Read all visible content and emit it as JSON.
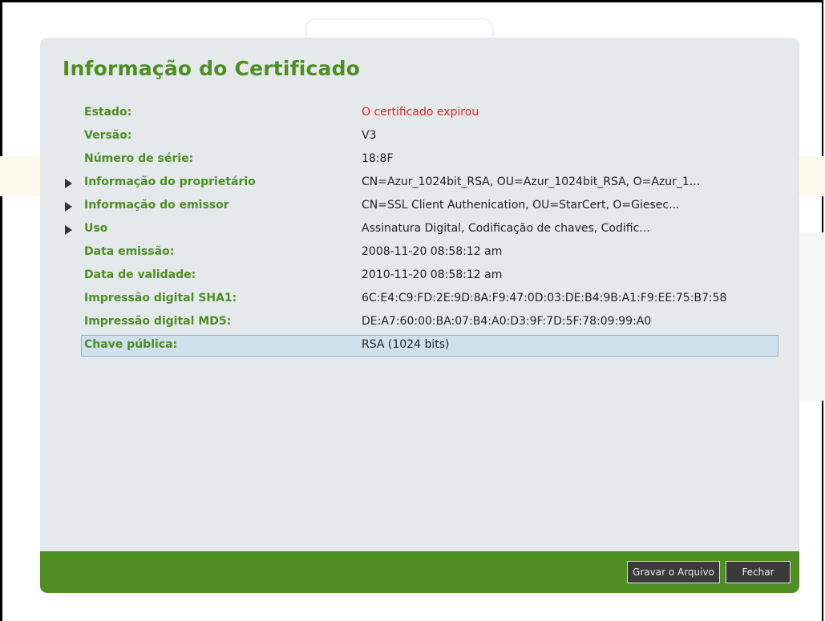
{
  "dialog": {
    "title": "Informação do Certificado",
    "rows": [
      {
        "label": "Estado:",
        "value": "O certificado expirou",
        "status": "error",
        "expandable": false
      },
      {
        "label": "Versão:",
        "value": "V3",
        "expandable": false
      },
      {
        "label": "Número de série:",
        "value": "18:8F",
        "expandable": false
      },
      {
        "label": "Informação do proprietário",
        "value": "CN=Azur_1024bit_RSA, OU=Azur_1024bit_RSA, O=Azur_1...",
        "expandable": true
      },
      {
        "label": "Informação do emissor",
        "value": "CN=SSL Client Authenication, OU=StarCert, O=Giesec...",
        "expandable": true
      },
      {
        "label": "Uso",
        "value": "Assinatura Digital, Codificação de chaves, Codific...",
        "expandable": true
      },
      {
        "label": "Data emissão:",
        "value": "2008-11-20 08:58:12 am",
        "expandable": false
      },
      {
        "label": "Data de validade:",
        "value": "2010-11-20 08:58:12 am",
        "expandable": false
      },
      {
        "label": "Impressão digital SHA1:",
        "value": "6C:E4:C9:FD:2E:9D:8A:F9:47:0D:03:DE:B4:9B:A1:F9:EE:75:B7:58",
        "expandable": false
      },
      {
        "label": "Impressão digital MD5:",
        "value": "DE:A7:60:00:BA:07:B4:A0:D3:9F:7D:5F:78:09:99:A0",
        "expandable": false
      },
      {
        "label": "Chave pública:",
        "value": "RSA (1024 bits)",
        "expandable": false,
        "selected": true
      }
    ],
    "buttons": {
      "save_label": "Gravar o Arquivo",
      "close_label": "Fechar"
    }
  },
  "colors": {
    "accent_green": "#4d8e22",
    "footer_green": "#4f8f22",
    "error_red": "#e82222",
    "selection_bg": "#cfe1ec"
  }
}
